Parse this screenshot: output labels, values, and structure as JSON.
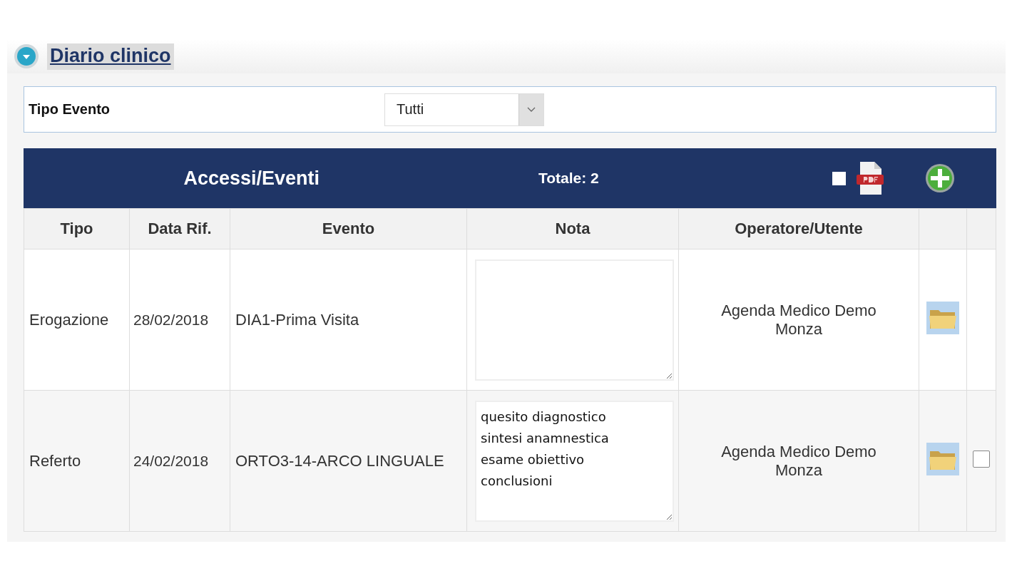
{
  "section": {
    "title": "Diario clinico",
    "expanded": true
  },
  "filter": {
    "label": "Tipo Evento",
    "value": "Tutti"
  },
  "table": {
    "title": "Accessi/Eventi",
    "total": "Totale: 2",
    "select_all_checked": false,
    "columns": [
      "Tipo",
      "Data Rif.",
      "Evento",
      "Nota",
      "Operatore/Utente"
    ],
    "rows": [
      {
        "tipo": "Erogazione",
        "data": "28/02/2018",
        "evento": "DIA1-Prima Visita",
        "nota": "",
        "operatore": "Agenda Medico Demo Monza"
      },
      {
        "tipo": "Referto",
        "data": "24/02/2018",
        "evento": "ORTO3-14-ARCO LINGUALE",
        "nota": "quesito diagnostico\nsintesi anamnestica\nesame obiettivo\nconclusioni",
        "operatore": "Agenda Medico Demo Monza",
        "checked": false
      }
    ]
  }
}
